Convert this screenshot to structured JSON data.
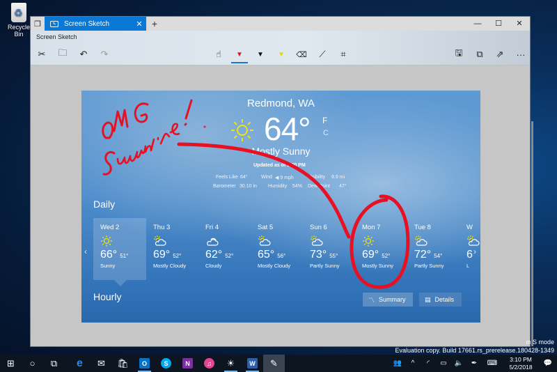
{
  "desktop": {
    "recycle_bin_label": "Recycle Bin"
  },
  "window": {
    "tab_title": "Screen Sketch",
    "app_title": "Screen Sketch",
    "new_tab": "+",
    "tab_close": "✕",
    "controls": {
      "minimize": "—",
      "maximize": "☐",
      "close": "✕"
    }
  },
  "toolbar": {
    "left": [
      {
        "name": "new-snip-icon",
        "glyph": "✂"
      },
      {
        "name": "open-folder-icon",
        "glyph": "🗀"
      },
      {
        "name": "undo-icon",
        "glyph": "↶"
      },
      {
        "name": "redo-icon",
        "glyph": "↷"
      }
    ],
    "center": [
      {
        "name": "touch-writing-icon",
        "glyph": "☝"
      },
      {
        "name": "ballpoint-pen-icon",
        "glyph": "▼",
        "color": "#e81123",
        "active": true
      },
      {
        "name": "pencil-icon",
        "glyph": "▼",
        "color": "#111111"
      },
      {
        "name": "highlighter-icon",
        "glyph": "▼",
        "color": "#f4e60a"
      },
      {
        "name": "eraser-icon",
        "glyph": "⌫"
      },
      {
        "name": "ruler-icon",
        "glyph": "⟋"
      },
      {
        "name": "crop-icon",
        "glyph": "⌗"
      }
    ],
    "right": [
      {
        "name": "save-icon",
        "glyph": "🖫"
      },
      {
        "name": "copy-icon",
        "glyph": "⧉"
      },
      {
        "name": "share-icon",
        "glyph": "⇗"
      },
      {
        "name": "more-icon",
        "glyph": "···"
      }
    ]
  },
  "weather": {
    "location": "Redmond, WA",
    "temperature": "64°",
    "unit_f": "F",
    "unit_c": "C",
    "condition": "Mostly Sunny",
    "updated": "Updated as of 3:00 PM",
    "details": {
      "feels_like_label": "Feels Like",
      "feels_like": "64°",
      "wind_label": "Wind",
      "wind": "◀ 9 mph",
      "visibility_label": "Visibility",
      "visibility": "9.9 mi",
      "barometer_label": "Barometer",
      "barometer": "30.10 in",
      "humidity_label": "Humidity",
      "humidity": "54%",
      "dew_point_label": "Dew Point",
      "dew_point": "47°"
    },
    "daily_label": "Daily",
    "hourly_label": "Hourly",
    "days": [
      {
        "day": "Wed 2",
        "icon": "sunny",
        "high": "66°",
        "low": "51°",
        "cond": "Sunny"
      },
      {
        "day": "Thu 3",
        "icon": "partly",
        "high": "69°",
        "low": "52°",
        "cond": "Mostly Cloudy"
      },
      {
        "day": "Fri 4",
        "icon": "cloudy",
        "high": "62°",
        "low": "52°",
        "cond": "Cloudy"
      },
      {
        "day": "Sat 5",
        "icon": "partly",
        "high": "65°",
        "low": "56°",
        "cond": "Mostly Cloudy"
      },
      {
        "day": "Sun 6",
        "icon": "partly",
        "high": "73°",
        "low": "55°",
        "cond": "Partly Sunny"
      },
      {
        "day": "Mon 7",
        "icon": "sunny",
        "high": "69°",
        "low": "52°",
        "cond": "Mostly Sunny"
      },
      {
        "day": "Tue 8",
        "icon": "partly",
        "high": "72°",
        "low": "54°",
        "cond": "Partly Sunny"
      },
      {
        "day": "W",
        "icon": "partly",
        "high": "6",
        "low": "",
        "cond": "L"
      }
    ],
    "summary_button": "Summary",
    "details_button": "Details",
    "prev_arrow": "‹",
    "next_arrow": "›"
  },
  "annotation": {
    "ink_color": "#e81123",
    "handwriting": "OMG Sunshine!"
  },
  "watermark": {
    "line1": "in S mode",
    "line2": "Evaluation copy. Build 17661.rs_prerelease.180428-1349"
  },
  "taskbar": {
    "apps": [
      {
        "name": "start-icon",
        "glyph": "⊞",
        "color": "#ffffff"
      },
      {
        "name": "cortana-icon",
        "glyph": "○",
        "color": "#ffffff"
      },
      {
        "name": "task-view-icon",
        "glyph": "⧉",
        "color": "#ffffff"
      },
      {
        "name": "edge-icon",
        "glyph": "e",
        "color": "#1f8cf0"
      },
      {
        "name": "mail-icon",
        "glyph": "✉",
        "color": "#ffffff"
      },
      {
        "name": "store-icon",
        "glyph": "🛍",
        "color": "#ffffff"
      },
      {
        "name": "outlook-icon",
        "glyph": "O",
        "color": "#0a72c6",
        "running": true
      },
      {
        "name": "skype-icon",
        "glyph": "S",
        "color": "#00a9f0"
      },
      {
        "name": "onenote-icon",
        "glyph": "N",
        "color": "#7b2fa0"
      },
      {
        "name": "itunes-icon",
        "glyph": "♫",
        "color": "#e84393"
      },
      {
        "name": "weather-icon",
        "glyph": "☀",
        "color": "#ffffff",
        "running": true
      },
      {
        "name": "word-icon",
        "glyph": "W",
        "color": "#2b5fad",
        "running": true
      },
      {
        "name": "screen-sketch-icon",
        "glyph": "✎",
        "color": "#ffffff",
        "active": true
      }
    ],
    "tray": {
      "people": "👥",
      "chevron": "^",
      "wifi": "◜",
      "battery": "▭",
      "volume": "🔈",
      "pen": "✒",
      "keyboard": "⌨",
      "time": "3:10 PM",
      "date": "5/2/2018",
      "notifications": "💬"
    }
  }
}
